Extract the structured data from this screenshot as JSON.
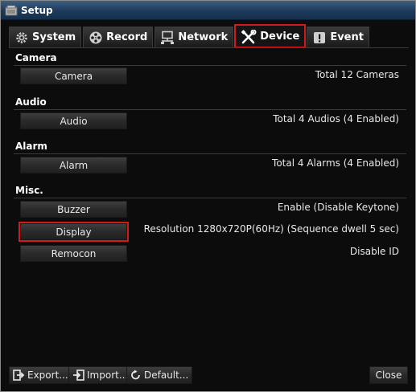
{
  "window": {
    "title": "Setup"
  },
  "tabs": [
    {
      "label": "System",
      "icon": "gear-icon"
    },
    {
      "label": "Record",
      "icon": "film-reel-icon"
    },
    {
      "label": "Network",
      "icon": "network-icon"
    },
    {
      "label": "Device",
      "icon": "tools-icon",
      "active": true
    },
    {
      "label": "Event",
      "icon": "alert-icon"
    }
  ],
  "sections": {
    "camera": {
      "title": "Camera",
      "button": "Camera",
      "info": "Total 12 Cameras"
    },
    "audio": {
      "title": "Audio",
      "button": "Audio",
      "info": "Total 4 Audios (4 Enabled)"
    },
    "alarm": {
      "title": "Alarm",
      "button": "Alarm",
      "info": "Total 4 Alarms (4 Enabled)"
    },
    "misc": {
      "title": "Misc.",
      "buzzer": {
        "button": "Buzzer",
        "info": "Enable (Disable Keytone)"
      },
      "display": {
        "button": "Display",
        "info": "Resolution 1280x720P(60Hz) (Sequence dwell 5 sec)"
      },
      "remocon": {
        "button": "Remocon",
        "info": "Disable ID"
      }
    }
  },
  "footer": {
    "export_label": "Export...",
    "import_label": "Import...",
    "default_label": "Default...",
    "close_label": "Close"
  },
  "colors": {
    "highlight": "#d11b1b",
    "titlebar": "#1d3a5a",
    "background": "#0c0c0c"
  }
}
